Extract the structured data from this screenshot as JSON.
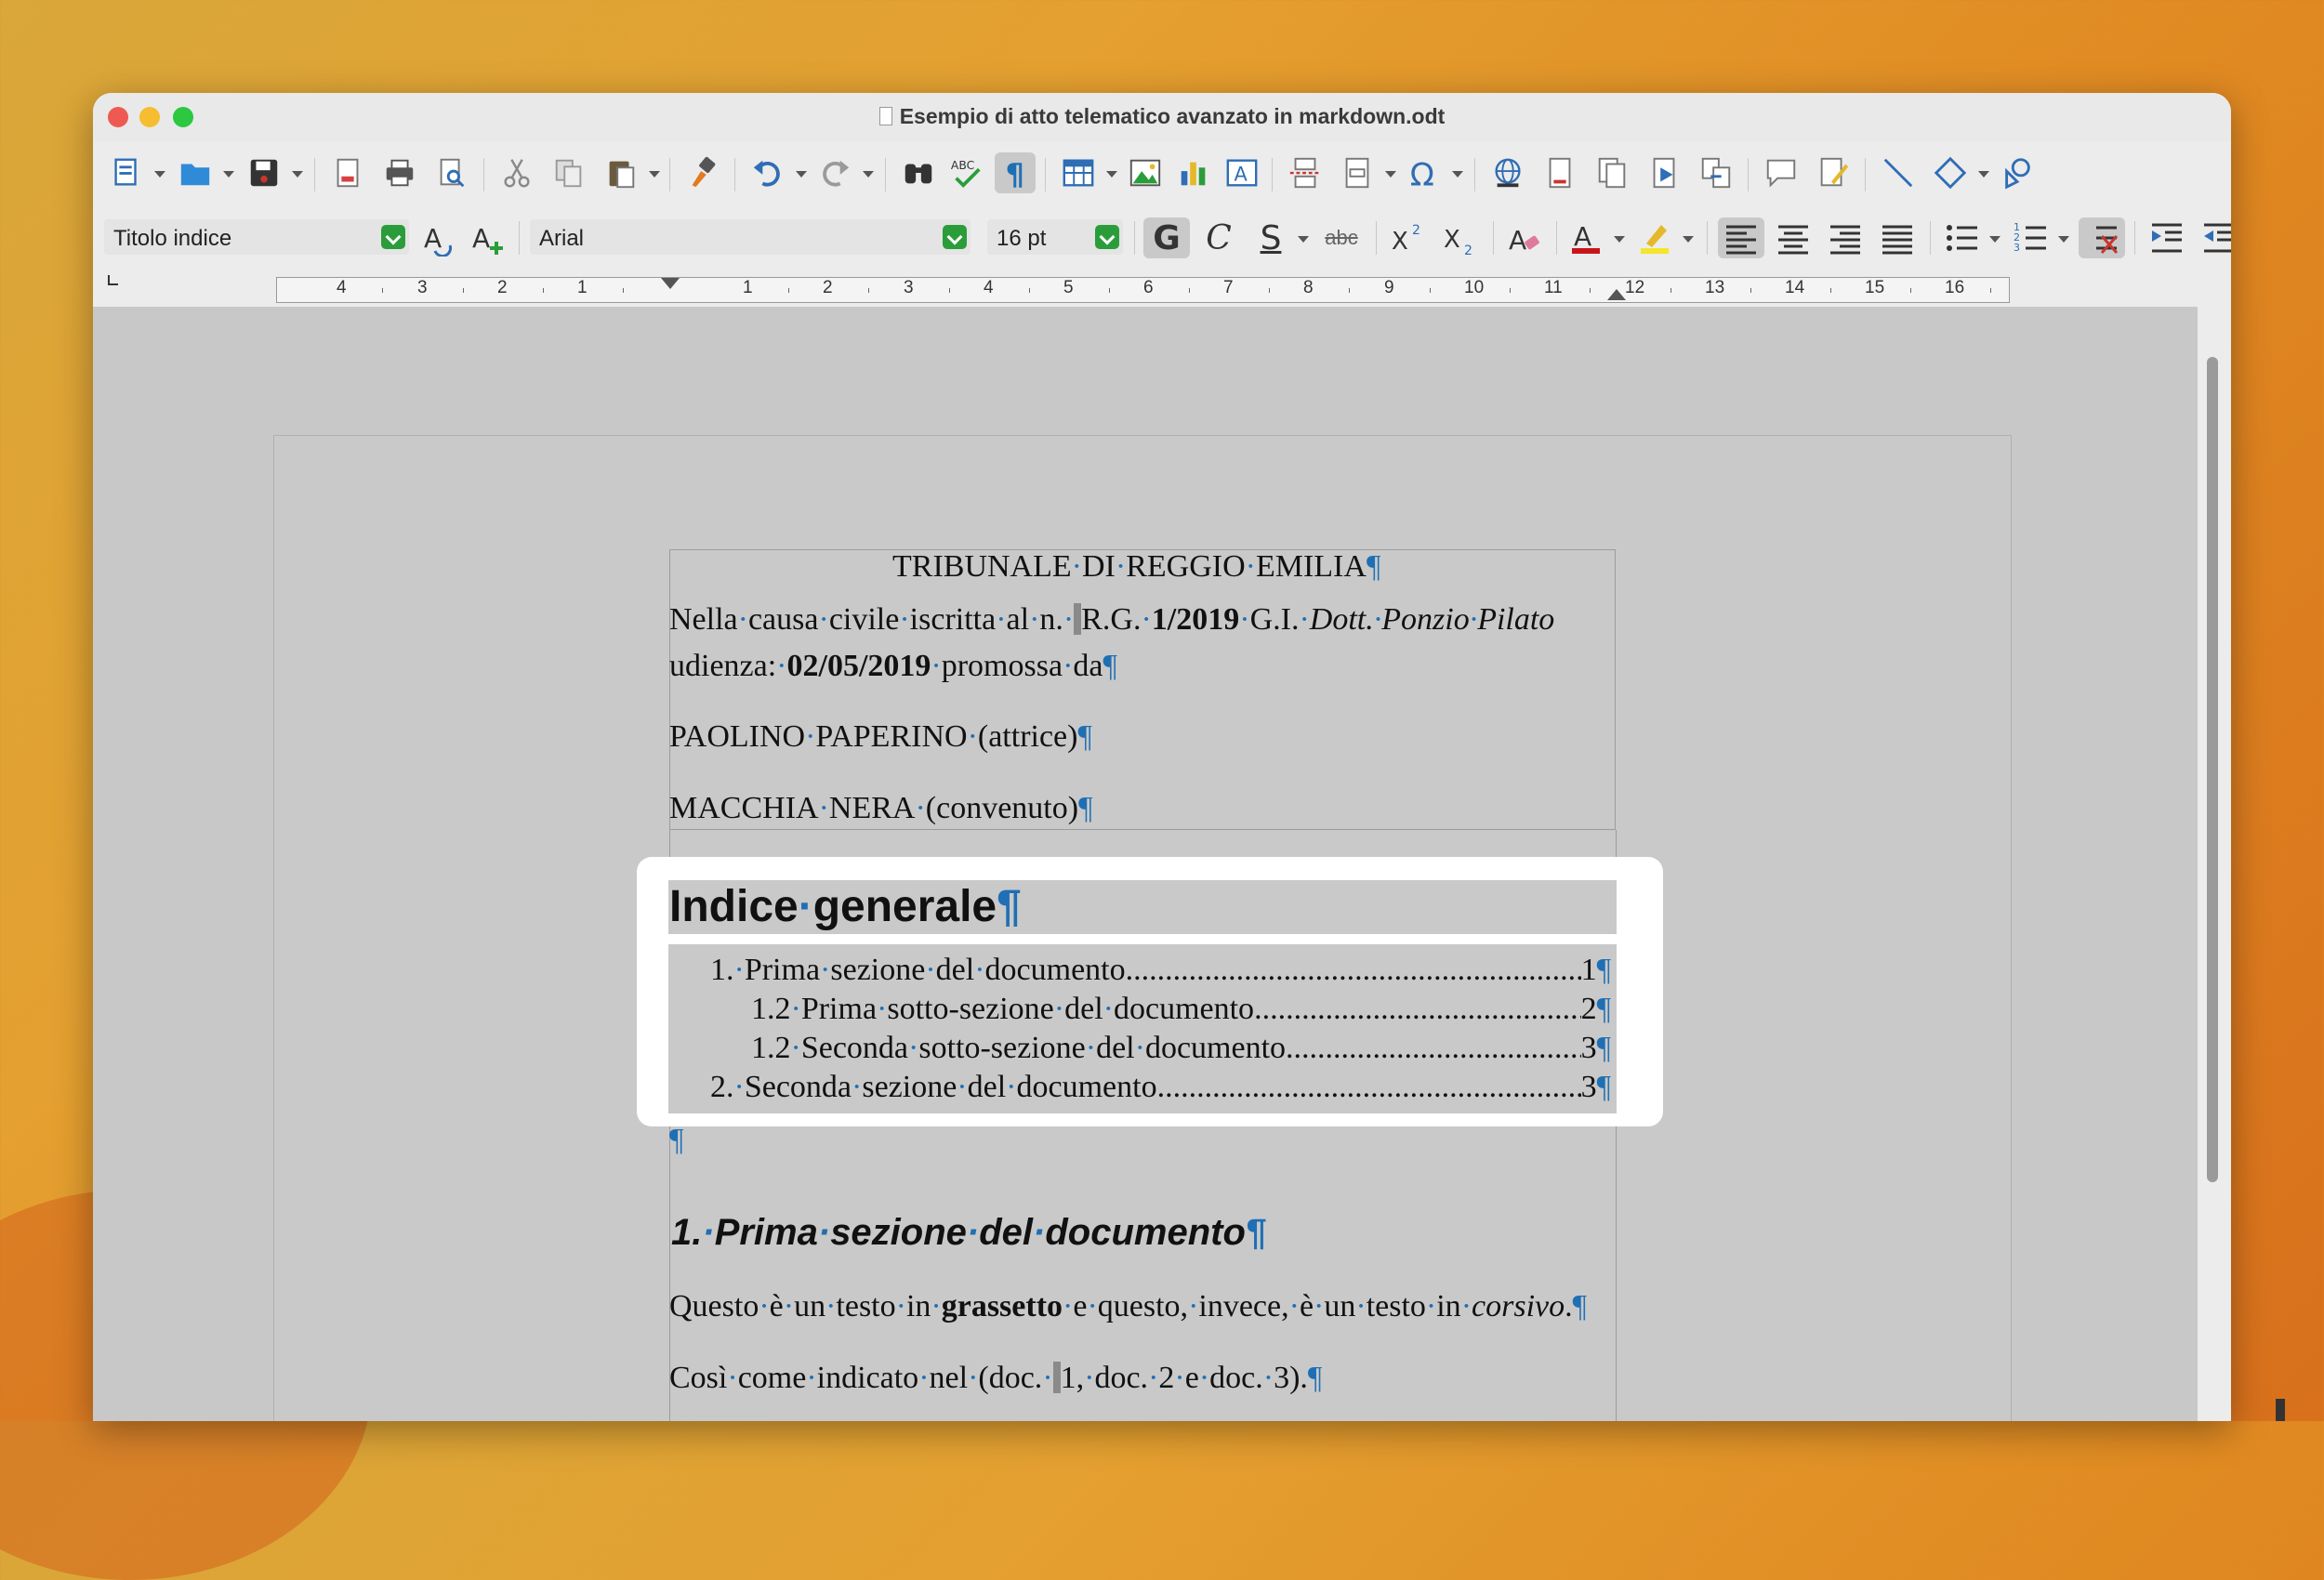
{
  "window": {
    "title": "Esempio di atto telematico avanzato in markdown.odt"
  },
  "format_bar": {
    "paragraph_style": "Titolo indice",
    "font_name": "Arial",
    "font_size": "16 pt",
    "bold_label": "G",
    "italic_label": "C",
    "underline_label": "S",
    "strike_label": "abc"
  },
  "ruler": {
    "labels": [
      "4",
      "3",
      "2",
      "1",
      "1",
      "2",
      "3",
      "4",
      "5",
      "6",
      "7",
      "8",
      "9",
      "10",
      "11",
      "12",
      "13",
      "14",
      "15",
      "16"
    ]
  },
  "document": {
    "court": "TRIBUNALE DI REGGIO EMILIA",
    "line1_a": "Nella causa civile iscritta al n. ",
    "line1_b": "R.G. ",
    "line1_rg": "1/2019",
    "line1_c": " G.I. ",
    "line1_judge": "Dott. Ponzio Pilato",
    "line2_a": "udienza: ",
    "line2_date": "02/05/2019",
    "line2_b": " promossa da",
    "plaintiff": "PAOLINO PAPERINO (attrice)",
    "defendant": "MACCHIA NERA (convenuto)",
    "toc_title": "Indice generale",
    "toc": [
      {
        "label": "1. Prima sezione del documento",
        "page": "1"
      },
      {
        "label": "1.2 Prima sotto-sezione del documento",
        "page": "2"
      },
      {
        "label": "1.2 Seconda sotto-sezione del documento",
        "page": "3"
      },
      {
        "label": "2. Seconda sezione del documento",
        "page": "3"
      }
    ],
    "heading1": "1. Prima sezione del documento",
    "para1_a": "Questo è un testo in ",
    "para1_bold": "grassetto",
    "para1_b": " e questo, invece, è un testo in ",
    "para1_italic": "corsivo",
    "para1_c": ".",
    "para2_a": "Così come indicato nel (doc. ",
    "para2_b": "1, doc. 2 e doc. 3)."
  },
  "pilcrow": "¶"
}
